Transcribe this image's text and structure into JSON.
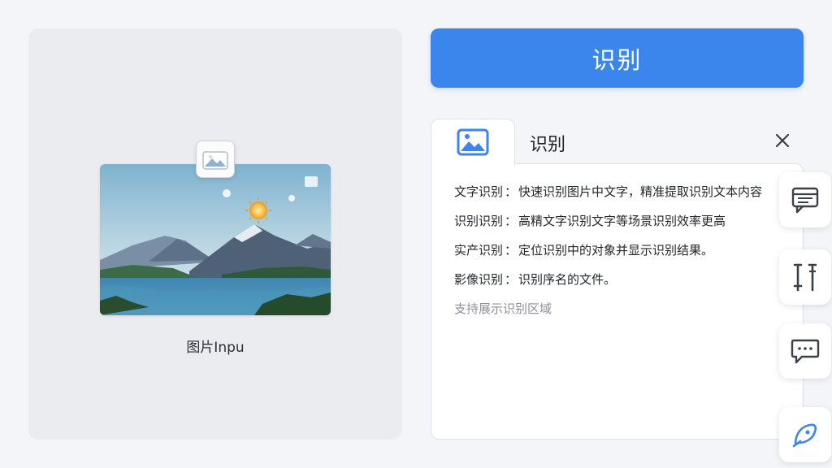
{
  "left_panel": {
    "file_label": "图片Inpu"
  },
  "recognize_button": {
    "label": "识别"
  },
  "result_card": {
    "tab_title": "识别",
    "lines": [
      {
        "label": "文字识别",
        "text": "快速识别图片中文字，精准提取识别文本内容"
      },
      {
        "label": "识别识别",
        "text": "高精文字识别文字等场景识别效率更高"
      },
      {
        "label": "实产识别",
        "text": "定位识别中的对象并显示识别结果。"
      },
      {
        "label": "影像识别",
        "text": "识别序名的文件。"
      }
    ],
    "hint": "支持展示识别区域"
  },
  "colors": {
    "accent": "#3b86ec",
    "icon_blue": "#3b86ec",
    "icon_dark": "#3a3f48"
  }
}
